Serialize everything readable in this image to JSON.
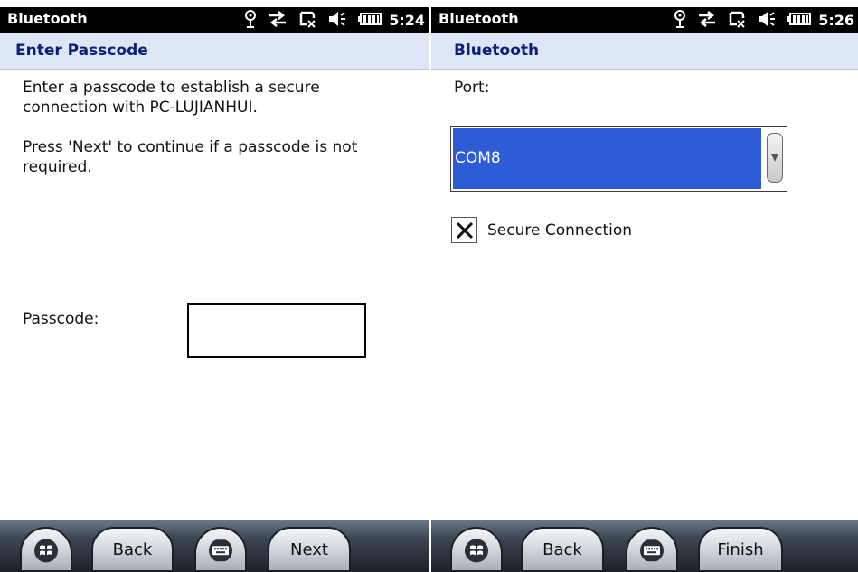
{
  "left_screen": {
    "status_title": "Bluetooth",
    "time": "5:24",
    "header_title": "Enter Passcode",
    "instruction_line1": "Enter a passcode to establish a secure",
    "instruction_line2": "connection with PC-LUJIANHUI.",
    "hint_line1": "Press 'Next' to continue if a passcode is not",
    "hint_line2": "required.",
    "passcode_label": "Passcode:",
    "passcode_value": "",
    "back_label": "Back",
    "next_label": "Next"
  },
  "right_screen": {
    "status_title": "Bluetooth",
    "time": "5:26",
    "header_title": "Bluetooth",
    "port_label": "Port:",
    "port_value": "COM8",
    "secure_label": "Secure Connection",
    "secure_checked": true,
    "back_label": "Back",
    "finish_label": "Finish"
  },
  "icons": {
    "status": [
      "signal-antenna-icon",
      "sync-arrows-icon",
      "phone-hangup-icon",
      "speaker-icon",
      "battery-icon"
    ],
    "taskbar": [
      "windows-start-icon",
      "keyboard-icon"
    ]
  },
  "colors": {
    "header_bg": "#dce6f4",
    "header_text": "#0d1f7a",
    "selection": "#2e5bd6"
  }
}
